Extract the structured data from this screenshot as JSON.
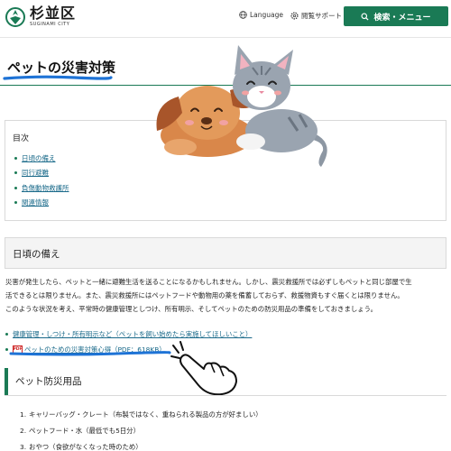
{
  "header": {
    "logo_name": "杉並区",
    "logo_sub": "SUGINAMI CITY",
    "language_label": "Language",
    "support_label": "閲覧サポート",
    "search_label": "検索・メニュー",
    "accent_color": "#1a7a55"
  },
  "page": {
    "title": "ペットの災害対策"
  },
  "toc": {
    "title": "目次",
    "items": [
      "日頃の備え",
      "同行避難",
      "負傷動物救護所",
      "関連情報"
    ]
  },
  "section1": {
    "heading": "日頃の備え",
    "paragraph_lines": [
      "災害が発生したら、ペットと一緒に避難生活を送ることになるかもしれません。しかし、震災救援所では必ずしもペットと同じ部屋で生",
      "活できるとは限りません。また、震災救援所にはペットフードや動物用の薬を備蓄しておらず、救援物資もすぐ届くとは限りません。",
      "このような状況を考え、平常時の健康管理としつけ、所有明示、そしてペットのための防災用品の準備をしておきましょう。"
    ],
    "links": [
      "健康管理・しつけ・所有明示など（ペットを飼い始めたら実施してほしいこと）",
      "ペットのための災害対策心得（PDF：618KB）"
    ],
    "pdf_badge": "PDF"
  },
  "section2": {
    "heading": "ペット防災用品",
    "items": [
      {
        "num": "1.",
        "text": "キャリーバッグ・クレート（布製ではなく、重ねられる製品の方が好ましい）"
      },
      {
        "num": "2.",
        "text": "ペットフード・水（最低でも5日分）"
      },
      {
        "num": "3.",
        "text": "おやつ（食欲がなくなった時のため）"
      }
    ]
  },
  "icons": {
    "globe": "globe-icon",
    "support": "gear-icon",
    "search": "search-icon",
    "pdf": "pdf-icon",
    "pointer": "pointing-hand-icon"
  }
}
